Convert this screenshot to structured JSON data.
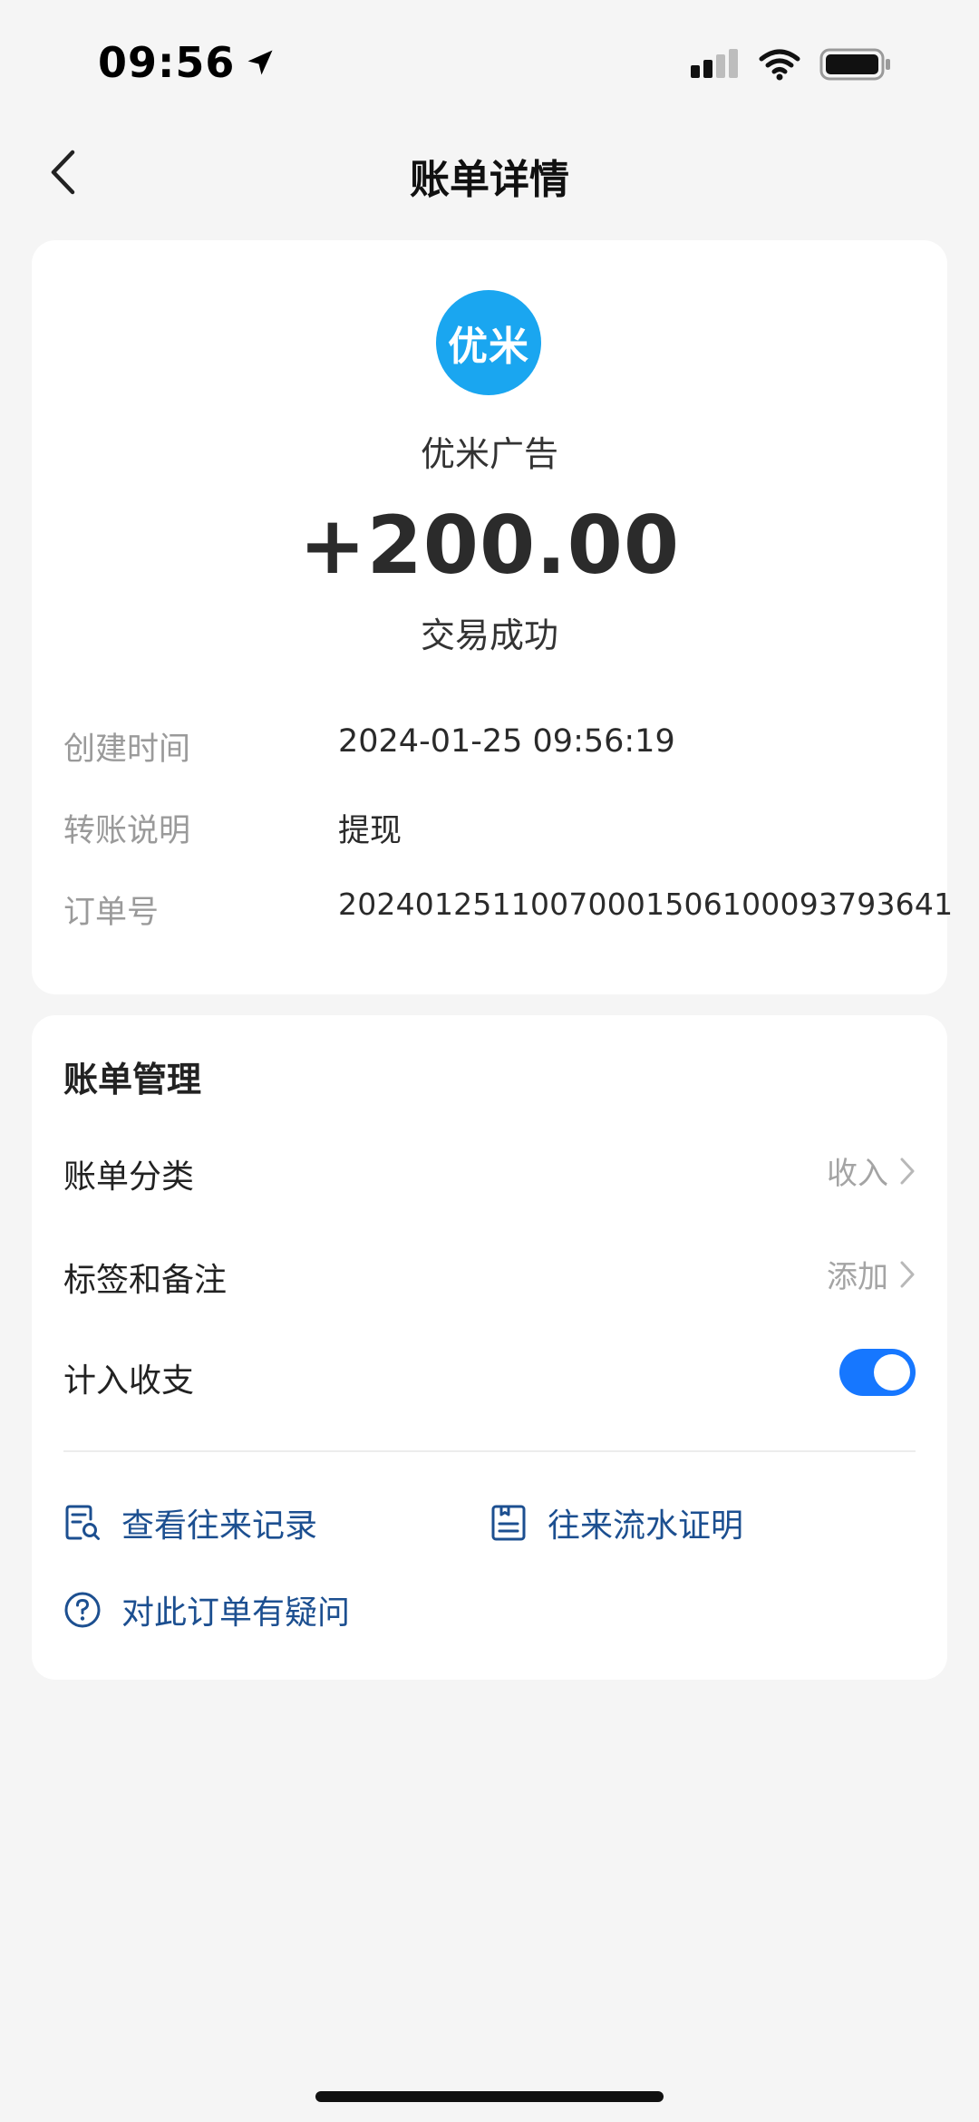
{
  "status_bar": {
    "time": "09:56"
  },
  "header": {
    "title": "账单详情"
  },
  "transaction": {
    "logo_text": "优米",
    "merchant": "优米广告",
    "amount": "+200.00",
    "status": "交易成功",
    "details": [
      {
        "label": "创建时间",
        "value": "2024-01-25 09:56:19"
      },
      {
        "label": "转账说明",
        "value": "提现"
      },
      {
        "label": "订单号",
        "value": "2024012511007000150610009379364​1"
      }
    ]
  },
  "bill_management": {
    "title": "账单管理",
    "category": {
      "label": "账单分类",
      "value": "收入"
    },
    "tags": {
      "label": "标签和备注",
      "value": "添加"
    },
    "include": {
      "label": "计入收支",
      "enabled": true
    },
    "actions": [
      {
        "label": "查看往来记录",
        "icon": "record-search-icon"
      },
      {
        "label": "往来流水证明",
        "icon": "document-icon"
      },
      {
        "label": "对此订单有疑问",
        "icon": "question-circle-icon"
      }
    ]
  },
  "colors": {
    "background": "#f5f5f5",
    "card": "#ffffff",
    "accent": "#1677ff",
    "logo": "#1aa6f0",
    "link": "#1c4f90"
  }
}
